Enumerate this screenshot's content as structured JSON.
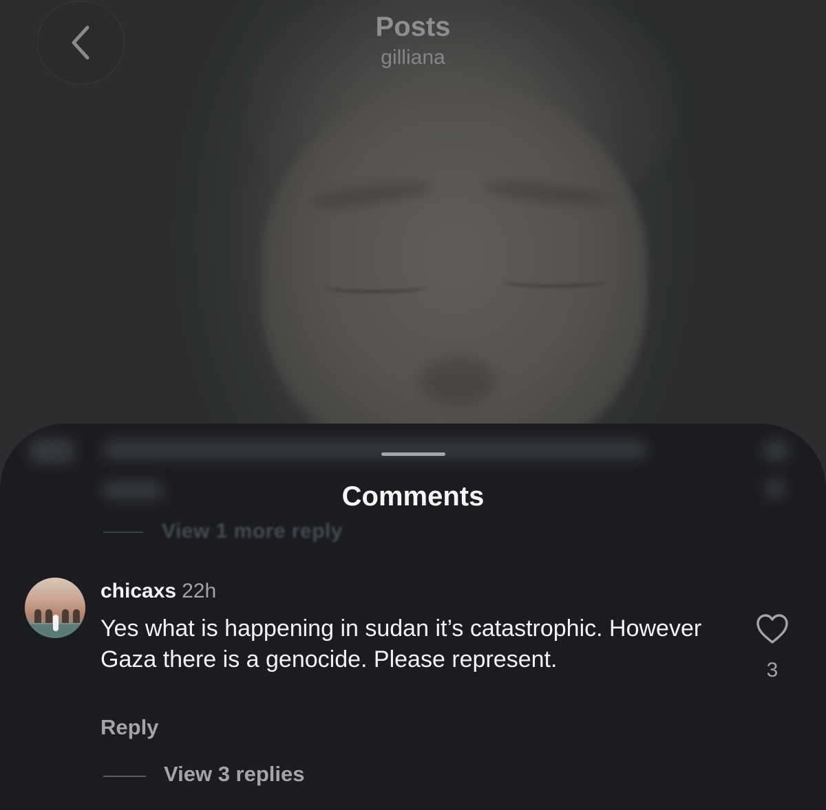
{
  "nav": {
    "title": "Posts",
    "subtitle": "gilliana",
    "back_icon": "chevron-left-icon"
  },
  "comments_sheet": {
    "title": "Comments",
    "blurred_reply_link": "View 1 more reply"
  },
  "comment": {
    "username": "chicaxs",
    "time": "22h",
    "text": "Yes what is happening in sudan it’s catastrophic. However Gaza there is a genocide. Please represent.",
    "reply_label": "Reply",
    "view_replies_label": "View 3 replies",
    "like_icon": "heart-outline-icon",
    "like_count": "3"
  },
  "colors": {
    "sheet_background": "#1b1c20",
    "primary_text": "#f4f4f5",
    "secondary_text": "#a4a5a9"
  }
}
